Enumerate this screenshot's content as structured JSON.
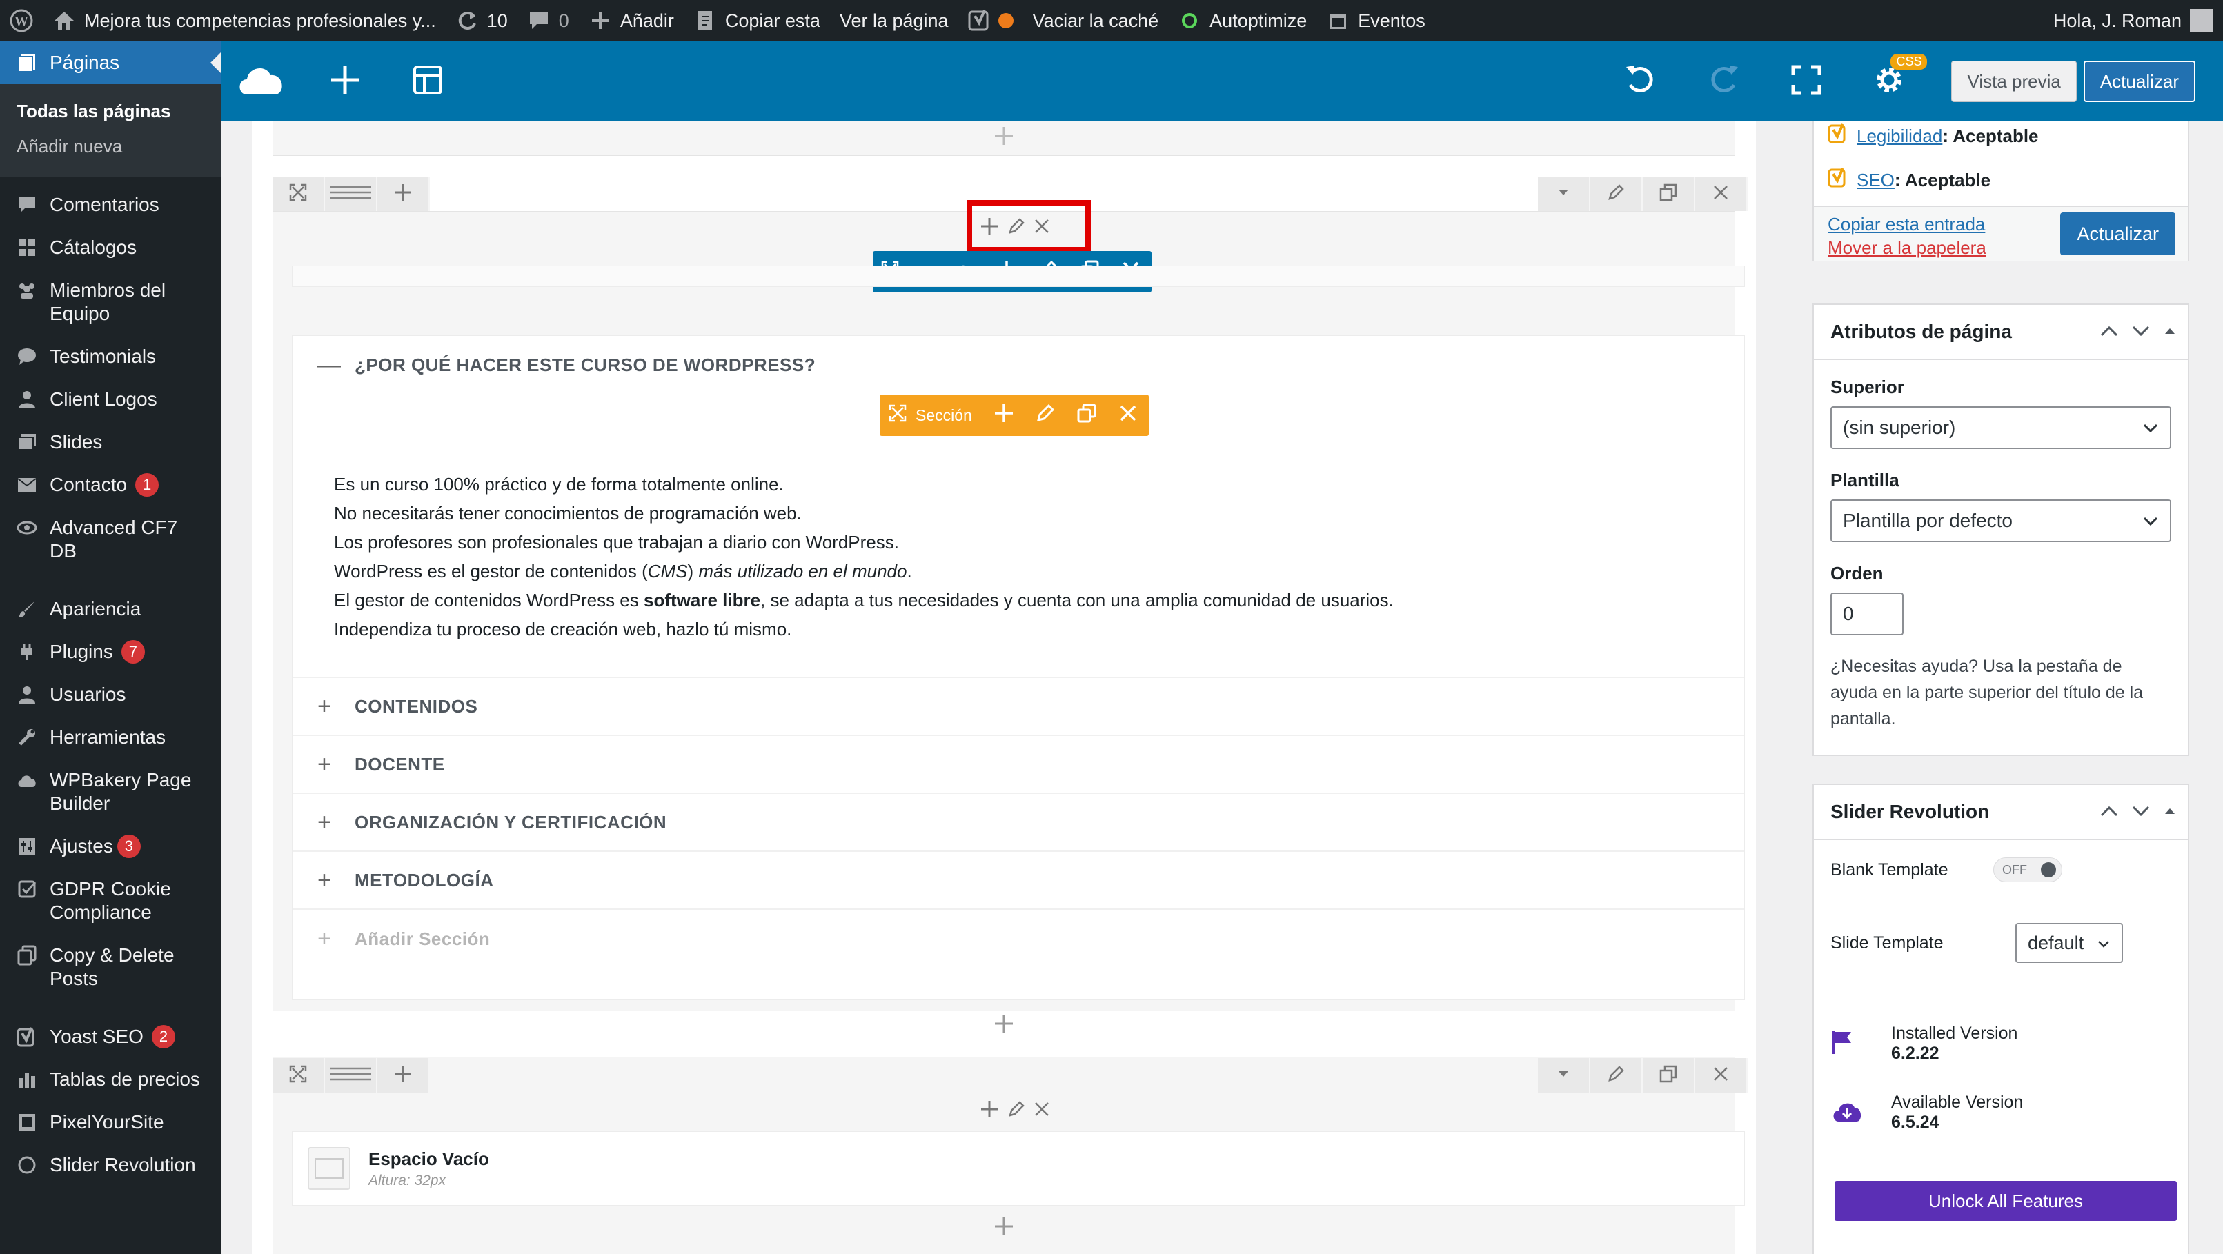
{
  "adminbar": {
    "site_title": "Mejora tus competencias profesionales y...",
    "updates_count": "10",
    "comments_count": "0",
    "add_new": "Añadir",
    "copy": "Copiar esta",
    "view_page": "Ver la página",
    "clear_cache": "Vaciar la caché",
    "autoptimize": "Autoptimize",
    "events": "Eventos",
    "greeting": "Hola, J. Roman"
  },
  "menu": {
    "current": "Páginas",
    "submenu": [
      "Todas las páginas",
      "Añadir nueva"
    ],
    "items": [
      {
        "label": "Comentarios",
        "badge": ""
      },
      {
        "label": "Cátalogos",
        "badge": ""
      },
      {
        "label": "Miembros del Equipo",
        "badge": ""
      },
      {
        "label": "Testimonials",
        "badge": ""
      },
      {
        "label": "Client Logos",
        "badge": ""
      },
      {
        "label": "Slides",
        "badge": ""
      },
      {
        "label": "Contacto",
        "badge": "1"
      },
      {
        "label": "Advanced CF7 DB",
        "badge": ""
      },
      {
        "label": "Apariencia",
        "badge": ""
      },
      {
        "label": "Plugins",
        "badge": "7"
      },
      {
        "label": "Usuarios",
        "badge": ""
      },
      {
        "label": "Herramientas",
        "badge": ""
      },
      {
        "label": "WPBakery Page Builder",
        "badge": ""
      },
      {
        "label": "Ajustes",
        "badge": "3"
      },
      {
        "label": "GDPR Cookie Compliance",
        "badge": ""
      },
      {
        "label": "Copy & Delete Posts",
        "badge": ""
      },
      {
        "label": "Yoast SEO",
        "badge": "2"
      },
      {
        "label": "Tablas de precios",
        "badge": ""
      },
      {
        "label": "PixelYourSite",
        "badge": ""
      },
      {
        "label": "Slider Revolution",
        "badge": ""
      }
    ]
  },
  "toolbar": {
    "css_badge": "CSS",
    "preview": "Vista previa",
    "update": "Actualizar"
  },
  "canvas": {
    "accordion_label": "Acordeón",
    "section_label": "Sección",
    "accordion_open_title": "¿POR QUÉ HACER ESTE CURSO DE WORDPRESS?",
    "content": {
      "line1": "Es un curso 100% práctico y de forma totalmente online.",
      "line2": "No necesitarás tener conocimientos de programación web.",
      "line3": "Los profesores son profesionales que trabajan a diario con WordPress.",
      "line4_a": "WordPress es el gestor de contenidos (",
      "line4_b": "CMS",
      "line4_c": ") ",
      "line4_d": "más utilizado en el mundo",
      "line4_e": ".",
      "line5_a": "El gestor de contenidos WordPress es ",
      "line5_b": "software libre",
      "line5_c": ", se adapta a tus necesidades y cuenta con una amplia comunidad de usuarios.",
      "line6": "Independiza tu proceso de creación web, hazlo tú mismo."
    },
    "sections": [
      "CONTENIDOS",
      "DOCENTE",
      "ORGANIZACIÓN Y CERTIFICACIÓN",
      "METODOLOGÍA"
    ],
    "add_section": "Añadir Sección",
    "empty_space_title": "Espacio Vacío",
    "empty_space_sub": "Altura: 32px"
  },
  "sidebar": {
    "yoast_readability_link": "Legibilidad",
    "yoast_readability_value": ": Aceptable",
    "yoast_seo_link": "SEO",
    "yoast_seo_value": ": Aceptable",
    "copy_entry": "Copiar esta entrada",
    "trash": "Mover a la papelera",
    "update_btn": "Actualizar",
    "page_attrs": {
      "title": "Atributos de página",
      "parent_label": "Superior",
      "parent_value": "(sin superior)",
      "template_label": "Plantilla",
      "template_value": "Plantilla por defecto",
      "order_label": "Orden",
      "order_value": "0",
      "help": "¿Necesitas ayuda? Usa la pestaña de ayuda en la parte superior del título de la pantalla."
    },
    "slider_rev": {
      "title": "Slider Revolution",
      "blank_template": "Blank Template",
      "toggle": "OFF",
      "slide_template": "Slide Template",
      "slide_template_value": "default",
      "installed_label": "Installed Version",
      "installed_value": "6.2.22",
      "available_label": "Available Version",
      "available_value": "6.5.24",
      "unlock": "Unlock All Features"
    }
  },
  "colors": {
    "admin_dark": "#1d2327",
    "builder_blue": "#0073aa",
    "section_orange": "#f6a21e",
    "highlight_red": "#e00000",
    "unlock_purple": "#5b2fb5"
  }
}
